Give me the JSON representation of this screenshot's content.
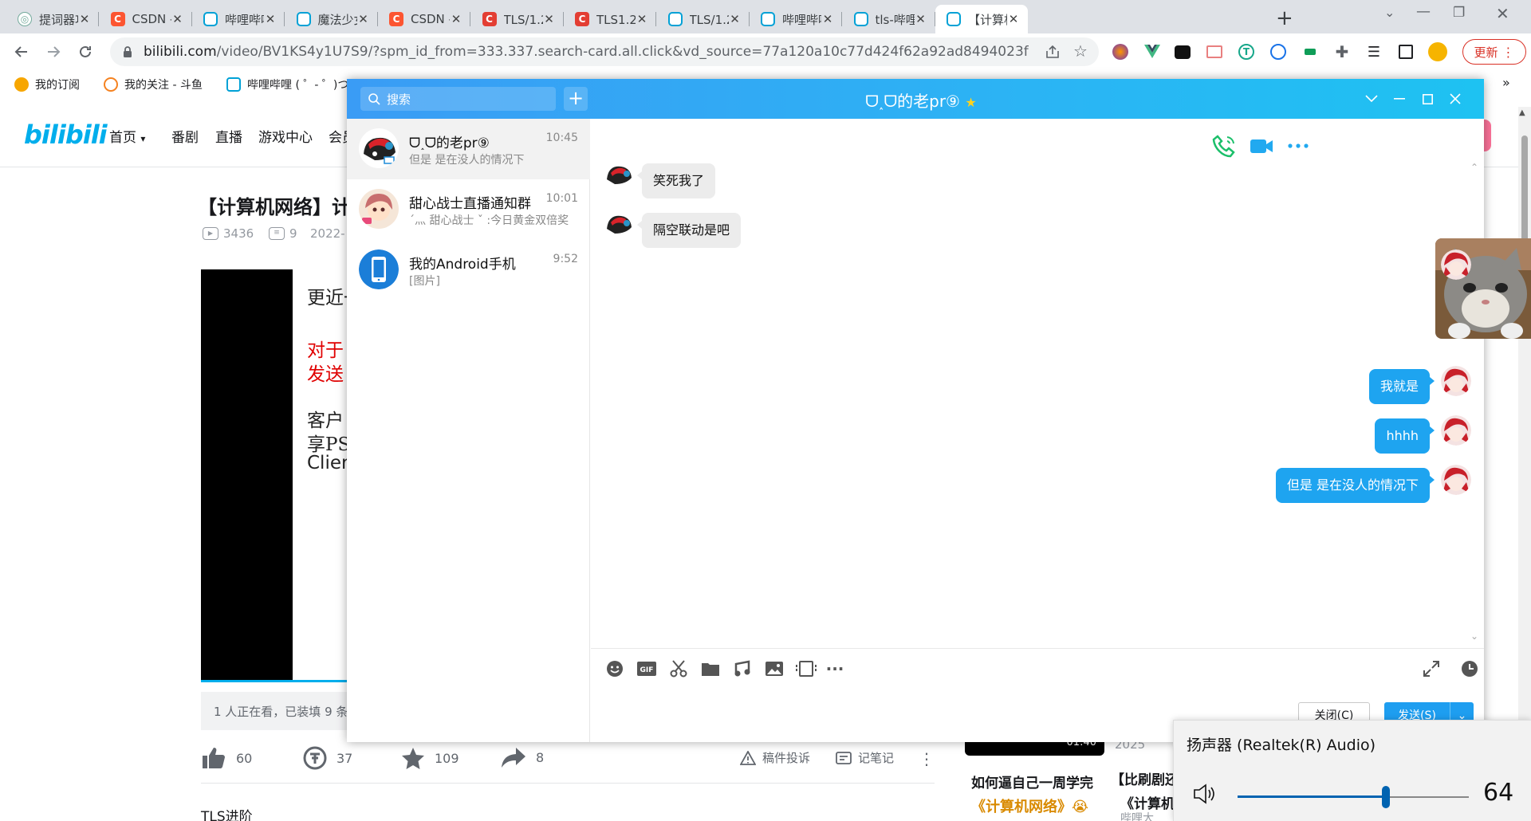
{
  "browser": {
    "tabs": [
      {
        "title": "提词器功",
        "favicon": "chatgpt-icon",
        "type": "gpt"
      },
      {
        "title": "CSDN - ",
        "favicon": "csdn-icon",
        "type": "csdn"
      },
      {
        "title": "哔哩哔哩",
        "favicon": "bilibili-icon",
        "type": "bili"
      },
      {
        "title": "魔法少女",
        "favicon": "bilibili-icon",
        "type": "bili"
      },
      {
        "title": "CSDN - ",
        "favicon": "csdn-icon",
        "type": "csdn"
      },
      {
        "title": "TLS/1.2和",
        "favicon": "csdn-icon",
        "type": "red"
      },
      {
        "title": "TLS1.2 和",
        "favicon": "csdn-icon",
        "type": "red"
      },
      {
        "title": "TLS/1.2和",
        "favicon": "bilibili-icon",
        "type": "bili"
      },
      {
        "title": "哔哩哔哩",
        "favicon": "bilibili-icon",
        "type": "bili"
      },
      {
        "title": "tls-哔哩哔",
        "favicon": "bilibili-icon",
        "type": "bili"
      },
      {
        "title": "【计算机",
        "favicon": "bilibili-icon",
        "type": "bili",
        "active": true
      }
    ],
    "url_host": "bilibili.com",
    "url_path": "/video/BV1KS4y1U7S9/?spm_id_from=333.337.search-card.all.click&vd_source=77a120a10c77d424f62a92ad8494023f",
    "update_label": "更新",
    "bookmarks": [
      "我的订阅",
      "我的关注 - 斗鱼",
      "哔哩哔哩 ( ゜- ゜)つ"
    ]
  },
  "bili": {
    "logo": "bilibili",
    "nav": [
      "首页",
      "番剧",
      "直播",
      "游戏中心",
      "会员"
    ],
    "video_title": "【计算机网络】计",
    "views": "3436",
    "danmaku": "9",
    "date": "2022-",
    "ppt_lines": [
      "更近一",
      "对于",
      "发送",
      "客户",
      "享PS",
      "Clier"
    ],
    "live_text": "1 人正在看，已装填 9 条",
    "likes": "60",
    "coins": "37",
    "favorites": "109",
    "shares": "8",
    "report_label": "稿件投诉",
    "notes_label": "记笔记",
    "tag": "TLS进阶",
    "side_duration": "01:40",
    "side_year": "2025",
    "side_card1_line1": "如何逼自己一周学完",
    "side_card1_line2": "《计算机网络》😭",
    "side_card2_line1": "【比刷剧还",
    "side_card2_line2": "《计算机",
    "side_card2_author": "哔哩大"
  },
  "qq": {
    "search_placeholder": "搜索",
    "add_label": "+",
    "peer_name": "ᗜ˰ᗜ的老pr⑨",
    "conversations": [
      {
        "name": "ᗜ˰ᗜ的老pr⑨",
        "time": "10:45",
        "preview": "但是 是在没人的情况下",
        "selected": true
      },
      {
        "name": "甜心战士直播通知群",
        "time": "10:01",
        "preview": "ˊ灬 甜心战士 ˇ :今日黄金双倍奖"
      },
      {
        "name": "我的Android手机",
        "time": "9:52",
        "preview": "[图片]"
      }
    ],
    "messages": [
      {
        "side": "in",
        "text": "笑死我了"
      },
      {
        "side": "in",
        "text": "隔空联动是吧"
      },
      {
        "side": "out",
        "type": "image",
        "desc": "cat-photo"
      },
      {
        "side": "out",
        "text": "我就是"
      },
      {
        "side": "out",
        "text": "hhhh"
      },
      {
        "side": "out",
        "text": "但是 是在没人的情况下"
      }
    ],
    "close_label": "关闭(C)",
    "send_label": "发送(S)",
    "colors": {
      "title_bar": "#2ba8f4",
      "out_bubble": "#1ea4f0",
      "in_bubble": "#ececec"
    }
  },
  "volume": {
    "device": "扬声器 (Realtek(R) Audio)",
    "level": 64
  }
}
